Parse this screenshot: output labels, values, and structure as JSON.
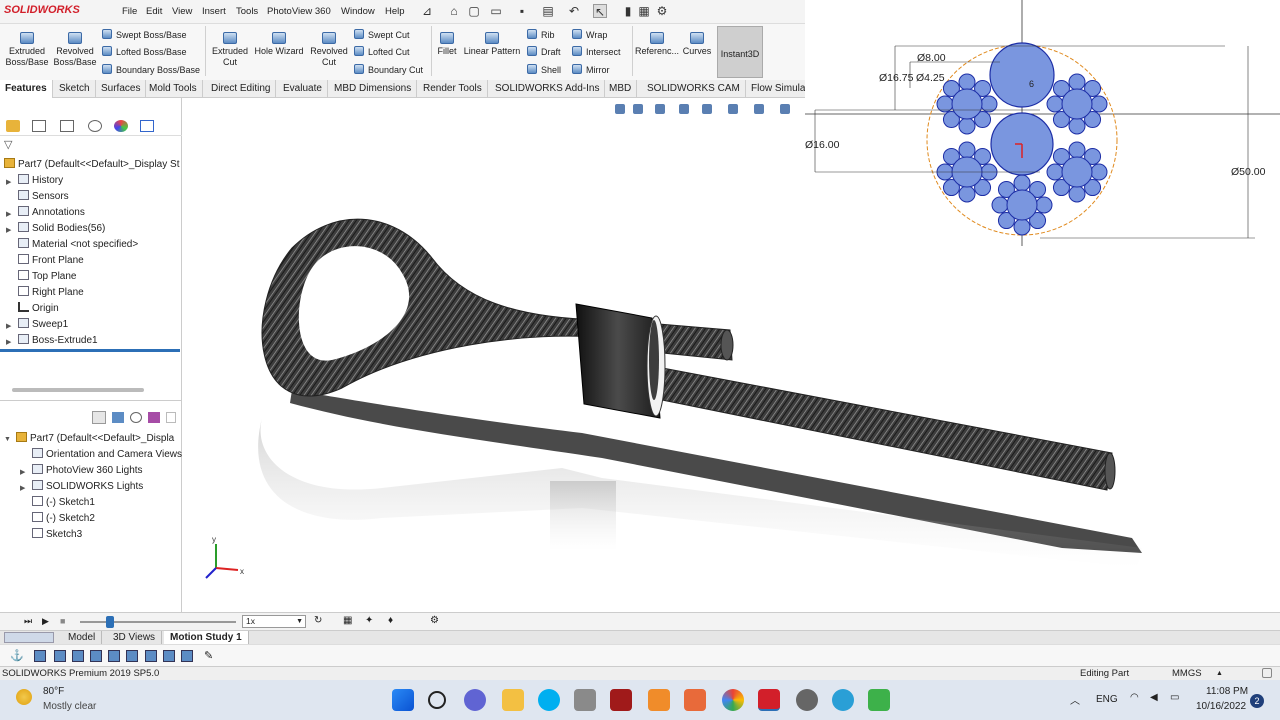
{
  "app": {
    "logo": "SOLIDWORKS"
  },
  "menu": [
    "File",
    "Edit",
    "View",
    "Insert",
    "Tools",
    "PhotoView 360",
    "Window",
    "Help"
  ],
  "ribbon": {
    "extruded_boss": "Extruded Boss/Base",
    "revolved_boss": "Revolved Boss/Base",
    "swept_boss": "Swept Boss/Base",
    "lofted_boss": "Lofted Boss/Base",
    "boundary_boss": "Boundary Boss/Base",
    "extruded_cut": "Extruded Cut",
    "hole_wizard": "Hole Wizard",
    "revolved_cut": "Revolved Cut",
    "swept_cut": "Swept Cut",
    "lofted_cut": "Lofted Cut",
    "boundary_cut": "Boundary Cut",
    "fillet": "Fillet",
    "linear_pattern": "Linear Pattern",
    "rib": "Rib",
    "draft": "Draft",
    "shell": "Shell",
    "wrap": "Wrap",
    "intersect": "Intersect",
    "mirror": "Mirror",
    "reference": "Referenc...",
    "curves": "Curves",
    "instant3d": "Instant3D"
  },
  "tabs": [
    "Features",
    "Sketch",
    "Surfaces",
    "Mold Tools",
    "Direct Editing",
    "Evaluate",
    "MBD Dimensions",
    "Render Tools",
    "SOLIDWORKS Add-Ins",
    "MBD",
    "SOLIDWORKS CAM",
    "Flow Simula"
  ],
  "feature_tree": {
    "root": "Part7  (Default<<Default>_Display St",
    "items": [
      "History",
      "Sensors",
      "Annotations",
      "Solid Bodies(56)",
      "Material <not specified>",
      "Front Plane",
      "Top Plane",
      "Right Plane",
      "Origin",
      "Sweep1",
      "Boss-Extrude1"
    ]
  },
  "display_tree": {
    "root": "Part7  (Default<<Default>_Displa",
    "items": [
      "Orientation and Camera Views",
      "PhotoView 360 Lights",
      "SOLIDWORKS Lights",
      "(-) Sketch1",
      "(-) Sketch2",
      "Sketch3"
    ]
  },
  "sketch_dims": {
    "d8": "Ø8.00",
    "d1675": "Ø16.75",
    "d425": "Ø4.25",
    "d16": "Ø16.00",
    "d50": "Ø50.00",
    "d6": "6"
  },
  "motion": {
    "speed": "1x"
  },
  "motion_tabs": [
    "Model",
    "3D Views",
    "Motion Study 1"
  ],
  "status": {
    "version": "SOLIDWORKS Premium 2019 SP5.0",
    "mode": "Editing Part",
    "units": "MMGS"
  },
  "taskbar": {
    "temp": "80°F",
    "weather": "Mostly clear",
    "lang": "ENG",
    "time": "11:08 PM",
    "date": "10/16/2022",
    "badge": "2"
  },
  "colors": {
    "accent": "#d21f2a",
    "sketch_fill": "#7a96df",
    "sketch_stroke": "#1d2ea6"
  }
}
